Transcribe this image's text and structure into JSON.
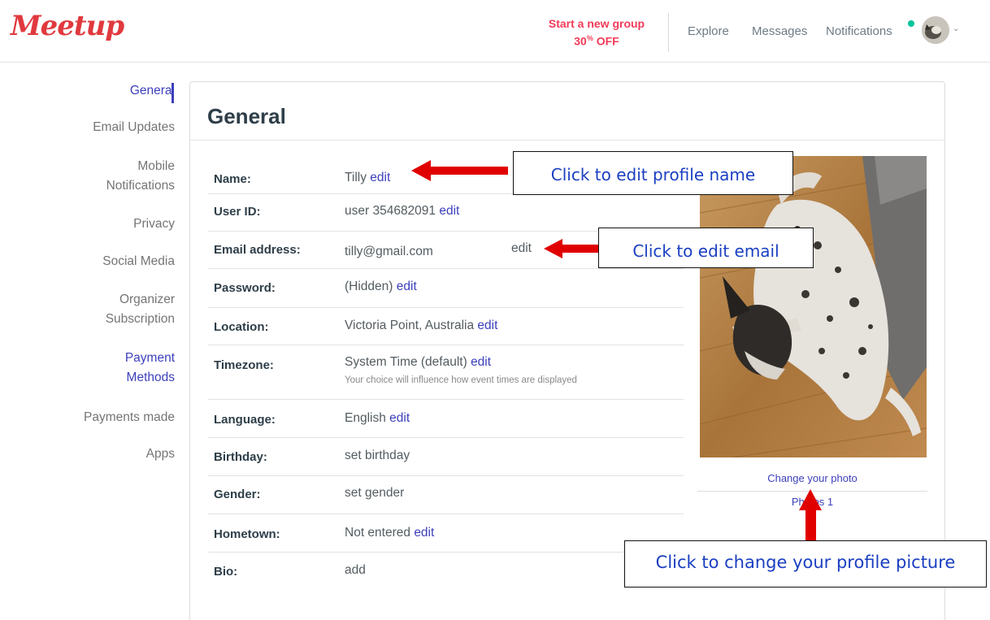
{
  "header": {
    "logo": "Meetup",
    "promo_line1": "Start a new group",
    "promo_pct": "30",
    "promo_pct_sup": "%",
    "promo_off": " OFF",
    "nav": [
      "Explore",
      "Messages",
      "Notifications"
    ]
  },
  "sidebar": {
    "items": [
      {
        "label": "General",
        "active": true
      },
      {
        "label": "Email Updates"
      },
      {
        "label": "Mobile Notifications",
        "line1": "Mobile",
        "line2": "Notifications"
      },
      {
        "label": "Privacy"
      },
      {
        "label": "Social Media"
      },
      {
        "label": "Organizer Subscription",
        "line1": "Organizer",
        "line2": "Subscription"
      },
      {
        "label": "Payment Methods",
        "line1": "Payment",
        "line2": "Methods"
      },
      {
        "label": "Payments made"
      },
      {
        "label": "Apps"
      }
    ]
  },
  "main": {
    "title": "General",
    "edit_label": "edit",
    "rows": [
      {
        "label": "Name:",
        "value": "Tilly",
        "action": "edit"
      },
      {
        "label": "User ID:",
        "value": "user 354682091",
        "action": "edit"
      },
      {
        "label": "Email address:",
        "value": "tilly@gmail.com",
        "action": "edit"
      },
      {
        "label": "Password:",
        "value": "(Hidden)",
        "action": "edit"
      },
      {
        "label": "Location:",
        "value": "Victoria Point, Australia",
        "action": "edit"
      },
      {
        "label": "Timezone:",
        "value": "System Time (default)",
        "action": "edit",
        "hint": "Your choice will influence how event times are displayed"
      },
      {
        "label": "Language:",
        "value": "English",
        "action": "edit"
      },
      {
        "label": "Birthday:",
        "value": "",
        "action": "set birthday"
      },
      {
        "label": "Gender:",
        "value": "",
        "action": "set gender"
      },
      {
        "label": "Hometown:",
        "value": "Not entered",
        "action": "edit"
      },
      {
        "label": "Bio:",
        "value": "",
        "action": "add"
      }
    ]
  },
  "photo": {
    "change_label": "Change your photo",
    "photos_label": "Photos 1"
  },
  "annotations": {
    "name": "Click to edit profile name",
    "email": "Click to edit email",
    "photo": "Click to change your profile picture"
  },
  "colors": {
    "brand": "#e0393e",
    "promo": "#f13a59",
    "link": "#3c3fbb",
    "arrow": "#e00000",
    "callout_text": "#1a3fc1",
    "notification_dot": "#00c49a"
  }
}
